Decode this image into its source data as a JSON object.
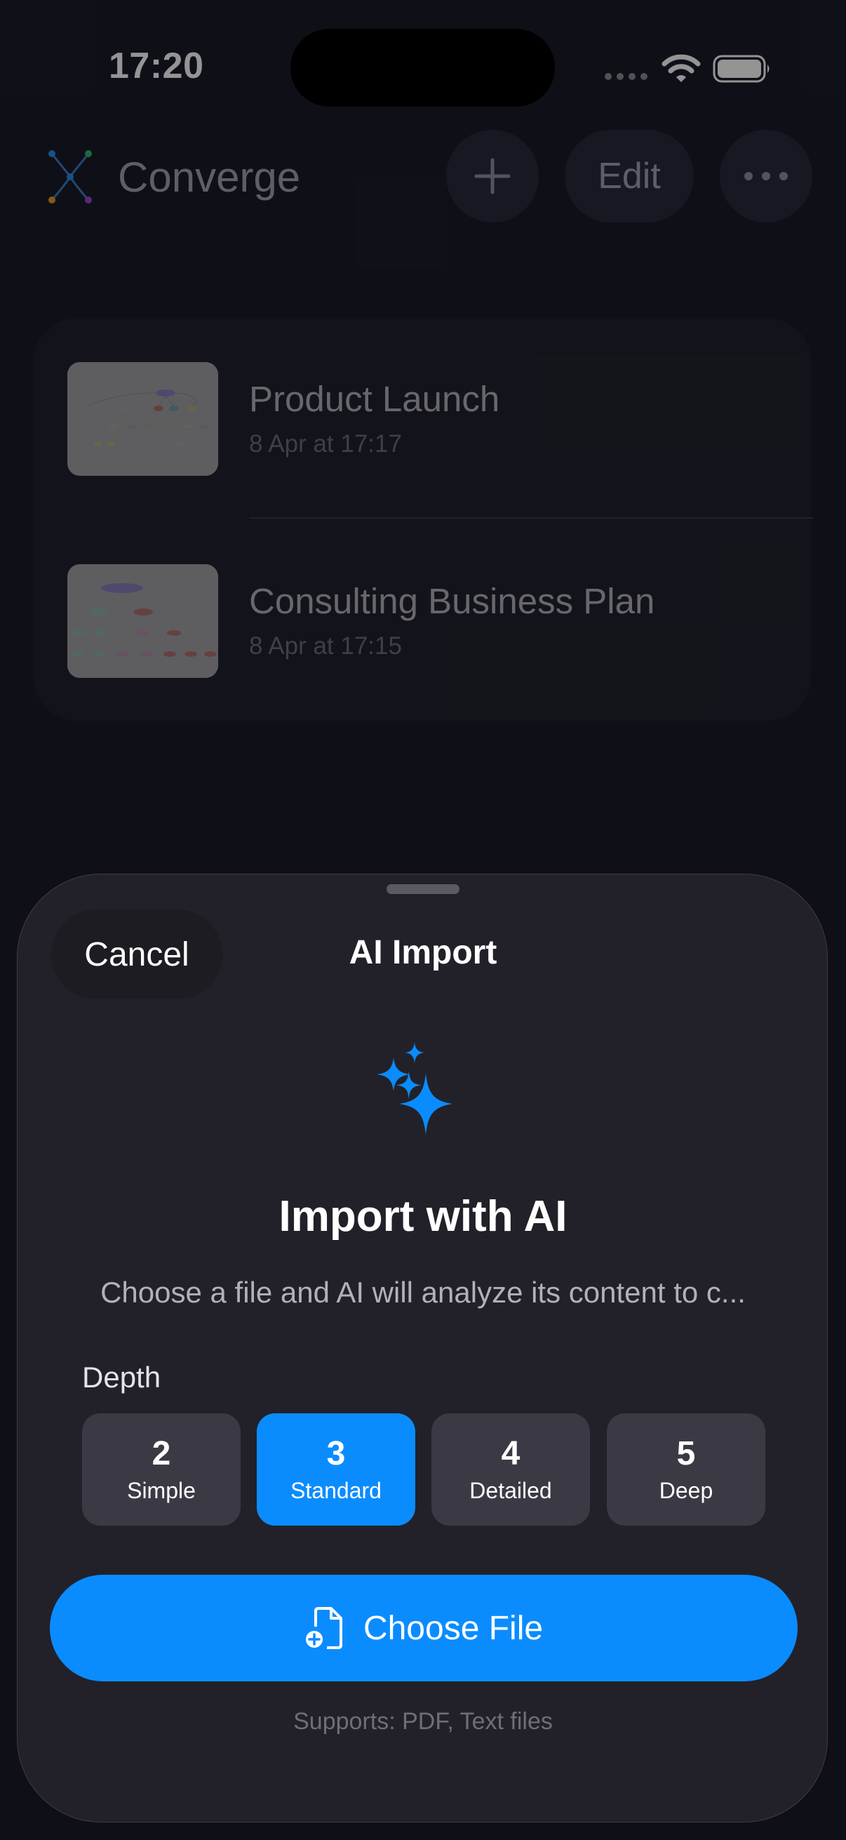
{
  "status_bar": {
    "time": "17:20"
  },
  "header": {
    "app_name": "Converge",
    "add_icon": "plus-icon",
    "edit_label": "Edit",
    "more_icon": "ellipsis-icon"
  },
  "projects": [
    {
      "title": "Product Launch",
      "date": "8 Apr at 17:17"
    },
    {
      "title": "Consulting Business Plan",
      "date": "8 Apr at 17:15"
    }
  ],
  "sheet": {
    "cancel_label": "Cancel",
    "title": "AI Import",
    "icon": "sparkles-icon",
    "heading": "Import with AI",
    "description": "Choose a file and AI will analyze its content to c...",
    "depth_label": "Depth",
    "depth_options": [
      {
        "value": "2",
        "label": "Simple",
        "selected": false
      },
      {
        "value": "3",
        "label": "Standard",
        "selected": true
      },
      {
        "value": "4",
        "label": "Detailed",
        "selected": false
      },
      {
        "value": "5",
        "label": "Deep",
        "selected": false
      }
    ],
    "choose_file_label": "Choose File",
    "choose_file_icon": "doc-add-icon",
    "supports_text": "Supports: PDF, Text files"
  },
  "colors": {
    "accent": "#0a8cff",
    "sheet_background": "#222129",
    "option_background": "#3b3a44"
  }
}
